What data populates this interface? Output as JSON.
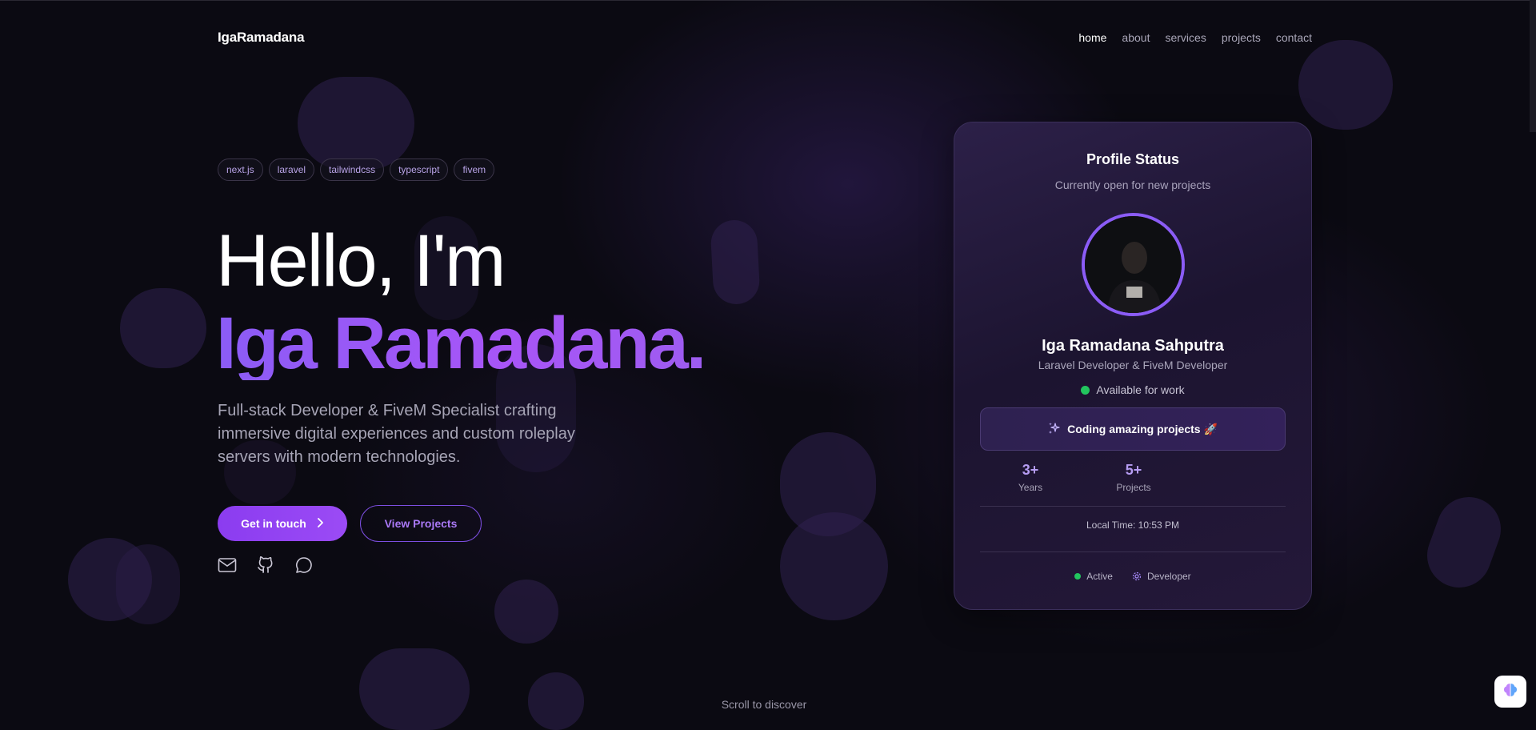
{
  "header": {
    "logo": "IgaRamadana",
    "nav": [
      {
        "label": "home",
        "active": true
      },
      {
        "label": "about",
        "active": false
      },
      {
        "label": "services",
        "active": false
      },
      {
        "label": "projects",
        "active": false
      },
      {
        "label": "contact",
        "active": false
      }
    ]
  },
  "hero": {
    "tags": [
      "next.js",
      "laravel",
      "tailwindcss",
      "typescript",
      "fivem"
    ],
    "greeting": "Hello, I'm",
    "name": "Iga Ramadana.",
    "tagline": "Full-stack Developer & FiveM Specialist crafting immersive digital experiences and custom roleplay servers with modern technologies.",
    "primary_button": "Get in touch",
    "secondary_button": "View Projects",
    "socials": [
      "mail-icon",
      "github-icon",
      "chat-icon"
    ]
  },
  "profile_card": {
    "title": "Profile Status",
    "subtitle": "Currently open for new projects",
    "name": "Iga Ramadana Sahputra",
    "role": "Laravel Developer & FiveM Developer",
    "availability": "Available for work",
    "activity": "Coding amazing projects 🚀",
    "stats": [
      {
        "value": "3+",
        "label": "Years"
      },
      {
        "value": "5+",
        "label": "Projects"
      }
    ],
    "local_time": "Local Time: 10:53 PM",
    "footer": {
      "status": "Active",
      "role": "Developer"
    }
  },
  "scroll_hint": "Scroll to discover",
  "colors": {
    "accent": "#8b5cf6",
    "background": "#0b0a12",
    "available": "#22c55e"
  }
}
